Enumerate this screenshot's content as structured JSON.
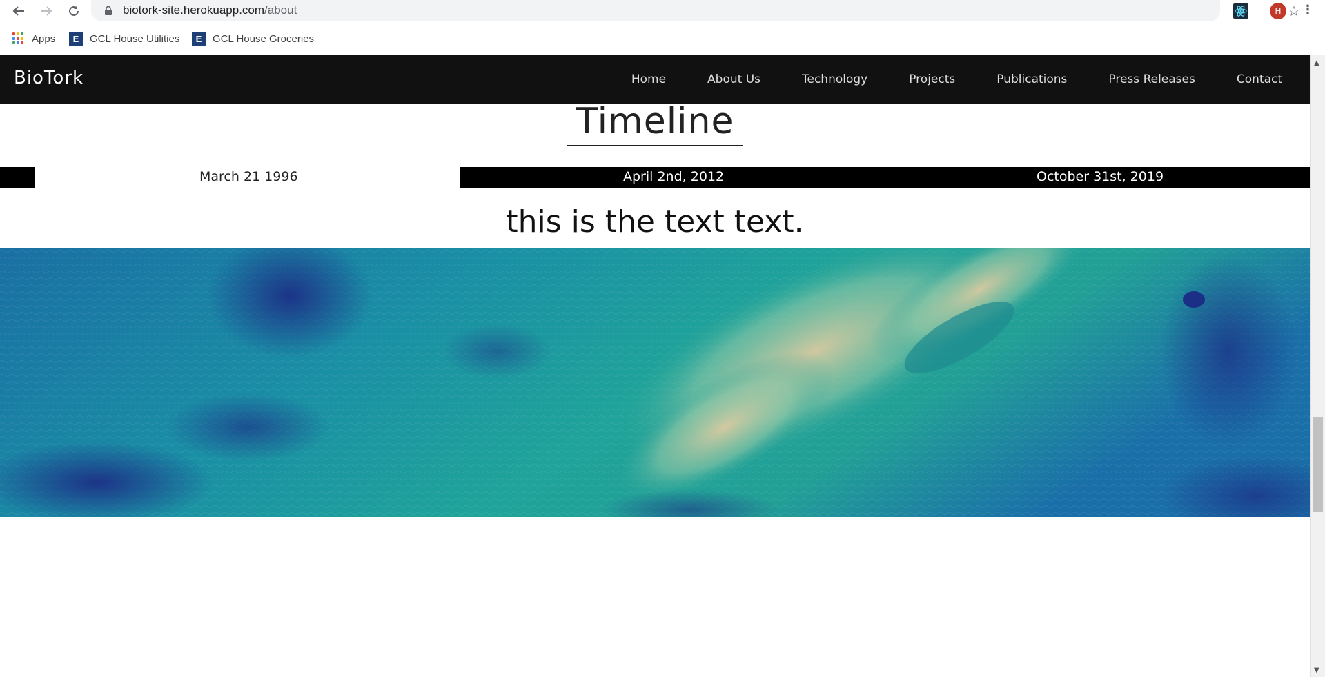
{
  "browser": {
    "url_host": "biotork-site.herokuapp.com",
    "url_path": "/about",
    "profile_initial": "H",
    "icons": {
      "back": "arrow-left-icon",
      "forward": "arrow-right-icon",
      "reload": "reload-icon",
      "lock": "lock-icon",
      "star": "star-icon",
      "extension": "react-devtools-icon",
      "menu": "kebab-menu-icon"
    }
  },
  "bookmarks": [
    {
      "label": "Apps",
      "icon": "apps-grid-icon"
    },
    {
      "label": "GCL House Utilities",
      "icon": "e-bookmark-icon"
    },
    {
      "label": "GCL House Groceries",
      "icon": "e-bookmark-icon"
    }
  ],
  "site": {
    "brand": "BioTork",
    "nav": [
      "Home",
      "About Us",
      "Technology",
      "Projects",
      "Publications",
      "Press Releases",
      "Contact"
    ]
  },
  "timeline": {
    "title": "Timeline",
    "dates": [
      "March 21 1996",
      "April 2nd, 2012",
      "October 31st, 2019"
    ],
    "text": "this is the text text."
  },
  "colors": {
    "navbar": "#111111",
    "timeline_active": "#000000",
    "avatar": "#c0392b",
    "hero_teal": "#1a9a9a",
    "hero_blue": "#1c3f8f",
    "hero_sand": "#d6c79c"
  }
}
